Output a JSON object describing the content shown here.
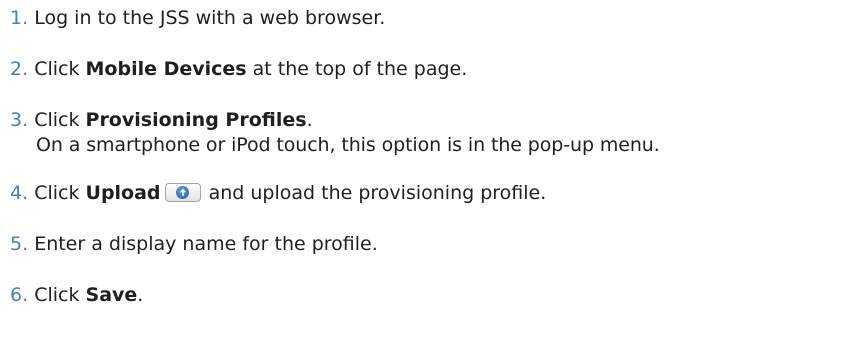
{
  "steps": [
    {
      "number": "1.",
      "before": "Log in to the JSS with a web browser.",
      "bold": "",
      "after": ""
    },
    {
      "number": "2.",
      "before": "Click ",
      "bold": "Mobile Devices",
      "after": " at the top of the page."
    },
    {
      "number": "3.",
      "before": "Click ",
      "bold": "Provisioning Profiles",
      "after": ".",
      "note": "On a smartphone or iPod touch, this option is in the pop-up menu."
    },
    {
      "number": "4.",
      "before": "Click ",
      "bold": "Upload",
      "icon": "upload-arrow-icon",
      "after": " and upload the provisioning profile."
    },
    {
      "number": "5.",
      "before": "Enter a display name for the profile.",
      "bold": "",
      "after": ""
    },
    {
      "number": "6.",
      "before": "Click ",
      "bold": "Save",
      "after": "."
    }
  ],
  "colors": {
    "number": "#4a7fb5",
    "text": "#1f1f1f",
    "icon_blue": "#1d5ea8"
  }
}
